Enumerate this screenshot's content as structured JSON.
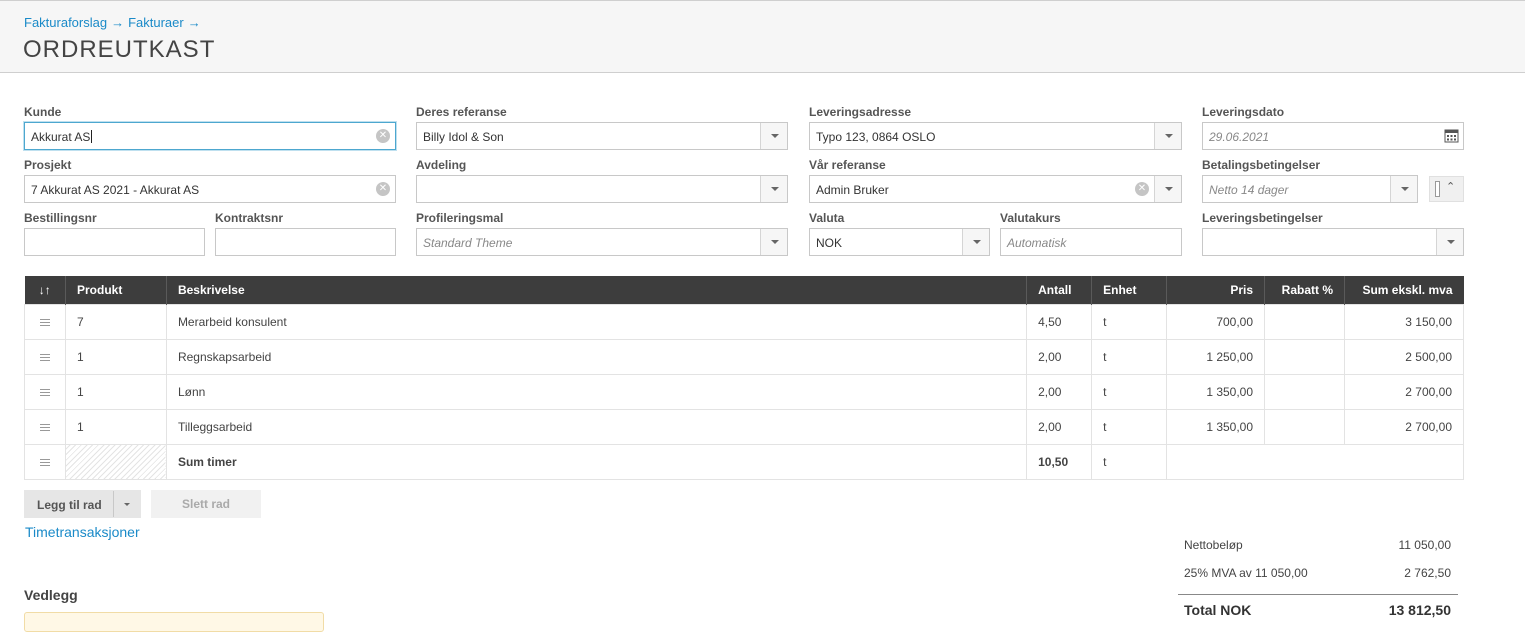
{
  "breadcrumb": [
    "Fakturaforslag",
    "Fakturaer"
  ],
  "breadcrumb_arrow": "→",
  "page_title": "ORDREUTKAST",
  "form": {
    "kunde_label": "Kunde",
    "kunde_value": "Akkurat AS",
    "deres_ref_label": "Deres referanse",
    "deres_ref_value": "Billy Idol & Son",
    "leveringsadresse_label": "Leveringsadresse",
    "leveringsadresse_value": "Typo 123, 0864 OSLO",
    "leveringsdato_label": "Leveringsdato",
    "leveringsdato_value": "29.06.2021",
    "prosjekt_label": "Prosjekt",
    "prosjekt_value": "7 Akkurat AS 2021 - Akkurat AS",
    "avdeling_label": "Avdeling",
    "avdeling_value": "",
    "var_ref_label": "Vår referanse",
    "var_ref_value": "Admin Bruker",
    "betaling_label": "Betalingsbetingelser",
    "betaling_placeholder": "Netto 14 dager",
    "bestillingsnr_label": "Bestillingsnr",
    "bestillingsnr_value": "",
    "kontraktsnr_label": "Kontraktsnr",
    "kontraktsnr_value": "",
    "profilering_label": "Profileringsmal",
    "profilering_placeholder": "Standard Theme",
    "valuta_label": "Valuta",
    "valuta_value": "NOK",
    "valutakurs_label": "Valutakurs",
    "valutakurs_placeholder": "Automatisk",
    "leveringsbet_label": "Leveringsbetingelser",
    "leveringsbet_value": ""
  },
  "table": {
    "sort_label": "↓↑",
    "columns": [
      "Produkt",
      "Beskrivelse",
      "Antall",
      "Enhet",
      "Pris",
      "Rabatt %",
      "Sum ekskl. mva"
    ],
    "rows": [
      {
        "produkt": "7",
        "beskrivelse": "Merarbeid konsulent",
        "antall": "4,50",
        "enhet": "t",
        "pris": "700,00",
        "rabatt": "",
        "sum": "3 150,00"
      },
      {
        "produkt": "1",
        "beskrivelse": "Regnskapsarbeid",
        "antall": "2,00",
        "enhet": "t",
        "pris": "1 250,00",
        "rabatt": "",
        "sum": "2 500,00"
      },
      {
        "produkt": "1",
        "beskrivelse": "Lønn",
        "antall": "2,00",
        "enhet": "t",
        "pris": "1 350,00",
        "rabatt": "",
        "sum": "2 700,00"
      },
      {
        "produkt": "1",
        "beskrivelse": "Tilleggsarbeid",
        "antall": "2,00",
        "enhet": "t",
        "pris": "1 350,00",
        "rabatt": "",
        "sum": "2 700,00"
      }
    ],
    "sum_row": {
      "beskrivelse": "Sum timer",
      "antall": "10,50",
      "enhet": "t"
    }
  },
  "buttons": {
    "add_row": "Legg til rad",
    "delete_row": "Slett rad"
  },
  "links": {
    "timetransaksjoner": "Timetransaksjoner"
  },
  "attachments_title": "Vedlegg",
  "totals": {
    "netto_label": "Nettobeløp",
    "netto_value": "11 050,00",
    "mva_label": "25% MVA av 11 050,00",
    "mva_value": "2 762,50",
    "total_label": "Total NOK",
    "total_value": "13 812,50"
  }
}
